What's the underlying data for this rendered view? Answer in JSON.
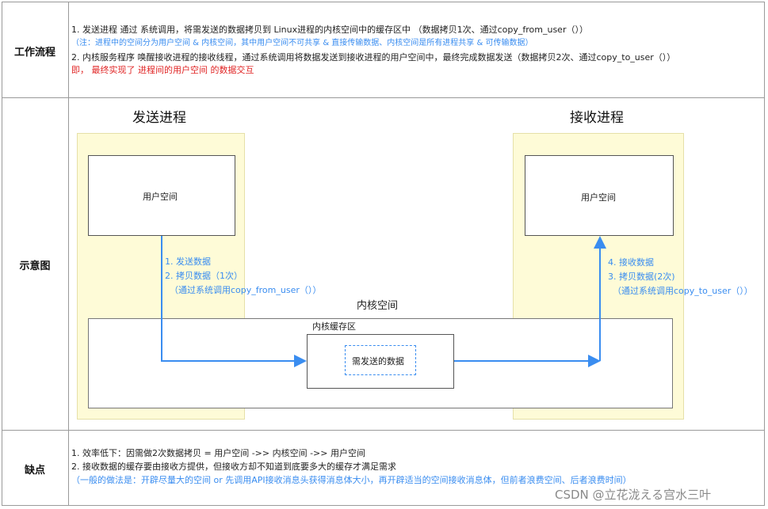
{
  "rows": {
    "workflow": {
      "label": "工作流程",
      "lines": [
        "1. 发送进程 通过 系统调用，将需发送的数据拷贝到 Linux进程的内核空间中的缓存区中 （数据拷贝1次、通过copy_from_user（））",
        "（注：进程中的空间分为用户空间 & 内核空间，其中用户空间不可共享 & 直接传输数据、内核空间是所有进程共享 & 可传输数据）",
        "2. 内核服务程序 唤醒接收进程的接收线程，通过系统调用将数据发送到接收进程的用户空间中，最终完成数据发送（数据拷贝2次、通过copy_to_user（））",
        "即， 最终实现了 进程间的用户空间 的数据交互"
      ]
    },
    "diagram": {
      "label": "示意图"
    },
    "drawbacks": {
      "label": "缺点",
      "lines": [
        "1. 效率低下：因需做2次数据拷贝 = 用户空间 ->> 内核空间 ->> 用户空间",
        "2. 接收数据的缓存要由接收方提供，但接收方却不知道到底要多大的缓存才满足需求",
        "（一般的做法是：开辟尽量大的空间 or 先调用API接收消息头获得消息体大小，再开辟适当的空间接收消息体，但前者浪费空间、后者浪费时间）"
      ]
    }
  },
  "diagram": {
    "send_title": "发送进程",
    "recv_title": "接收进程",
    "send_user_space": "用户空间",
    "recv_user_space": "用户空间",
    "kernel_space": "内核空间",
    "kernel_buffer": "内核缓存区",
    "payload": "需发送的数据",
    "send_steps": [
      "1. 发送数据",
      "2. 拷贝数据（1次）",
      "（通过系统调用copy_from_user（））"
    ],
    "recv_steps": [
      "4. 接收数据",
      "3. 拷贝数据(2次)",
      "（通过系统调用copy_to_user（））"
    ]
  },
  "colors": {
    "accent_blue": "#3a8df0",
    "highlight_red": "#e02424",
    "process_bg": "#fefbd7"
  },
  "watermark": "CSDN @立花泷える宫水三叶"
}
